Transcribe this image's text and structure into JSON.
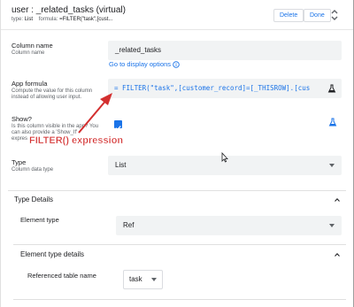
{
  "header": {
    "title": "user : _related_tasks (virtual)",
    "type_key": "type:",
    "type_value": "List",
    "formula_key": "formula:",
    "formula_value": "=FILTER(\"task\",[cust...",
    "delete_label": "Delete",
    "done_label": "Done"
  },
  "column_name": {
    "label": "Column name",
    "help": "Column name",
    "value": "_related_tasks",
    "display_link": "Go to display options"
  },
  "app_formula": {
    "label": "App formula",
    "help": "Compute the value for this column instead of allowing user input.",
    "value": "= FILTER(\"task\",[customer_record]=[_THISROW].[cus"
  },
  "show": {
    "label": "Show?",
    "help": "Is this column visible in the app? You can also provide a 'Show_If' expression",
    "checked": true
  },
  "annotation": {
    "text": "FILTER() expression",
    "color": "#d32f2f"
  },
  "type": {
    "label": "Type",
    "help": "Column data type",
    "value": "List"
  },
  "type_details": {
    "title": "Type Details",
    "element_type_label": "Element type",
    "element_type_value": "Ref"
  },
  "element_type_details": {
    "title": "Element type details",
    "ref_table_label": "Referenced table name",
    "ref_table_value": "task"
  },
  "colors": {
    "accent": "#1a73e8",
    "annotation_red": "#d32f2f"
  }
}
